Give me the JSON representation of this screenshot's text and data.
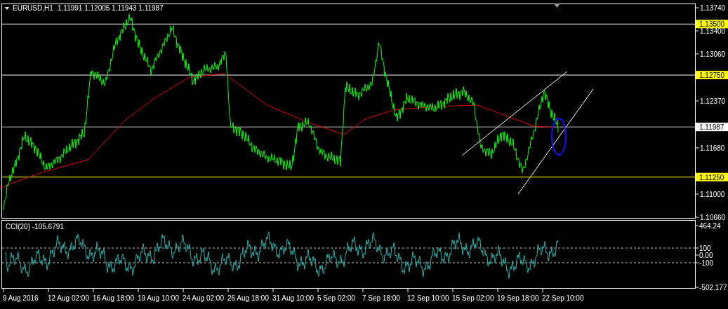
{
  "title": {
    "symbol": "EURUSD,H1",
    "prices": "1.11991 1.12005 1.11943 1.11987"
  },
  "price_axis": [
    "1.13740",
    "1.13400",
    "1.13060",
    "1.12370",
    "1.11680",
    "1.11000",
    "1.10660"
  ],
  "levels": [
    {
      "label": "1.13500",
      "kind": "plain",
      "color": "#ffff00"
    },
    {
      "label": "1.12750",
      "kind": "plain",
      "color": "#ffff00"
    },
    {
      "label": "1.11987",
      "kind": "bid",
      "color": "#ffffff"
    },
    {
      "label": "1.11250",
      "kind": "highlight",
      "color": "#ffff00"
    }
  ],
  "indicator": {
    "name": "CCI(20) -105.6791",
    "scale": [
      "464.24",
      "100",
      "0.00",
      "-100",
      "-502.177"
    ]
  },
  "time_axis": [
    "9 Aug 2016",
    "12 Aug 02:00",
    "16 Aug 18:00",
    "19 Aug 10:00",
    "24 Aug 02:00",
    "26 Aug 18:00",
    "31 Aug 10:00",
    "5 Sep 02:00",
    "7 Sep 18:00",
    "12 Sep 10:00",
    "15 Sep 02:00",
    "19 Sep 18:00",
    "22 Sep 10:00"
  ]
}
